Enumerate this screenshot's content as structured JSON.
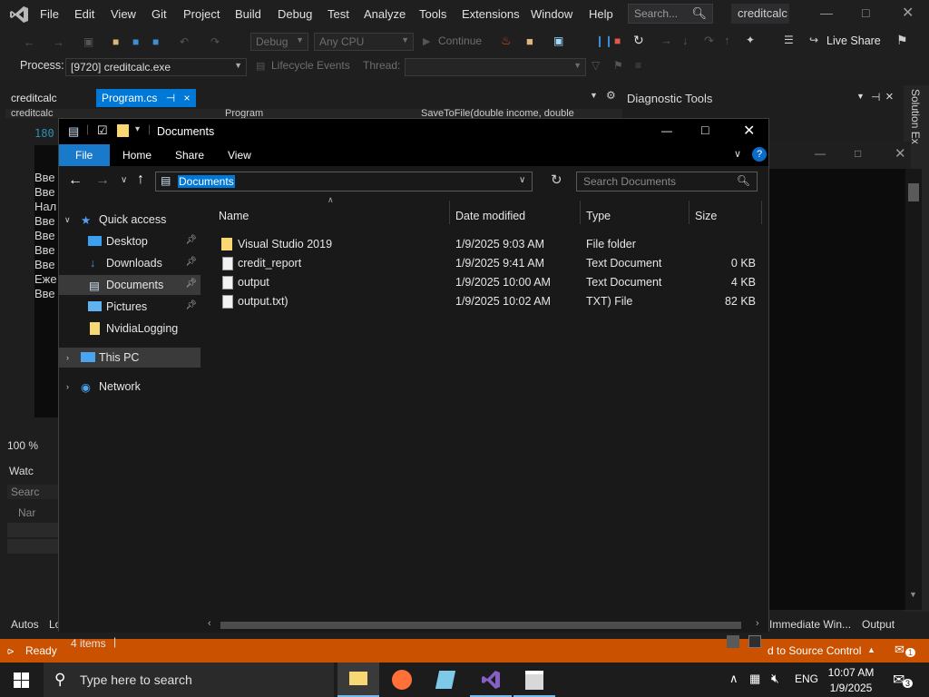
{
  "vs": {
    "menu": [
      "File",
      "Edit",
      "View",
      "Git",
      "Project",
      "Build",
      "Debug",
      "Test",
      "Analyze",
      "Tools",
      "Extensions",
      "Window",
      "Help"
    ],
    "search_placeholder": "Search...",
    "solution_name": "creditcalc",
    "toolbar": {
      "config": "Debug",
      "platform": "Any CPU",
      "continue": "Continue",
      "live_share": "Live Share"
    },
    "toolbar2": {
      "process_label": "Process:",
      "process_value": "[9720] creditcalc.exe",
      "lifecycle": "Lifecycle Events",
      "thread": "Thread:"
    },
    "tabs": {
      "project": "creditcalc",
      "active": "Program.cs",
      "active_pin": "⊣",
      "close": "×",
      "under1": "creditcalc",
      "under2": "Program",
      "under3": "SaveToFile(double income, double"
    },
    "editor": {
      "line_no": "180",
      "lines": [
        "Вве",
        "Вве",
        "Нал",
        "Вве",
        "Вве",
        "Вве",
        "Вве",
        "Еже",
        "Вве"
      ],
      "zoom": "100 %"
    },
    "diag_title": "Diagnostic Tools",
    "solution_strip": "Solution Ex",
    "bottom": {
      "watch": "Watc",
      "search": "Searc",
      "name": "Nar",
      "autos": "Autos",
      "locals": "Lo",
      "immediate": "Immediate Win...",
      "output": "Output"
    },
    "status": {
      "ready": "Ready",
      "source_control": "d to Source Control",
      "notif_count": "1"
    }
  },
  "explorer": {
    "title": "Documents",
    "ribbon": [
      "File",
      "Home",
      "Share",
      "View"
    ],
    "address": "Documents",
    "search_placeholder": "Search Documents",
    "nav": {
      "quick_access": "Quick access",
      "items": [
        "Desktop",
        "Downloads",
        "Documents",
        "Pictures",
        "NvidiaLogging"
      ],
      "this_pc": "This PC",
      "network": "Network"
    },
    "columns": [
      "Name",
      "Date modified",
      "Type",
      "Size"
    ],
    "files": [
      {
        "name": "Visual Studio 2019",
        "date": "1/9/2025 9:03 AM",
        "type": "File folder",
        "size": ""
      },
      {
        "name": "credit_report",
        "date": "1/9/2025 9:41 AM",
        "type": "Text Document",
        "size": "0 KB"
      },
      {
        "name": "output",
        "date": "1/9/2025 10:00 AM",
        "type": "Text Document",
        "size": "4 KB"
      },
      {
        "name": "output.txt)",
        "date": "1/9/2025 10:02 AM",
        "type": "TXT) File",
        "size": "82 KB"
      }
    ],
    "status_items": "4 items"
  },
  "taskbar": {
    "search_placeholder": "Type here to search",
    "lang": "ENG",
    "time": "10:07 AM",
    "date": "1/9/2025",
    "notif_count": "3"
  },
  "colors": {
    "accent": "#0078d7",
    "status_orange": "#ca5100",
    "vs_purple": "#8661c5",
    "folder_yellow": "#f8d775"
  }
}
